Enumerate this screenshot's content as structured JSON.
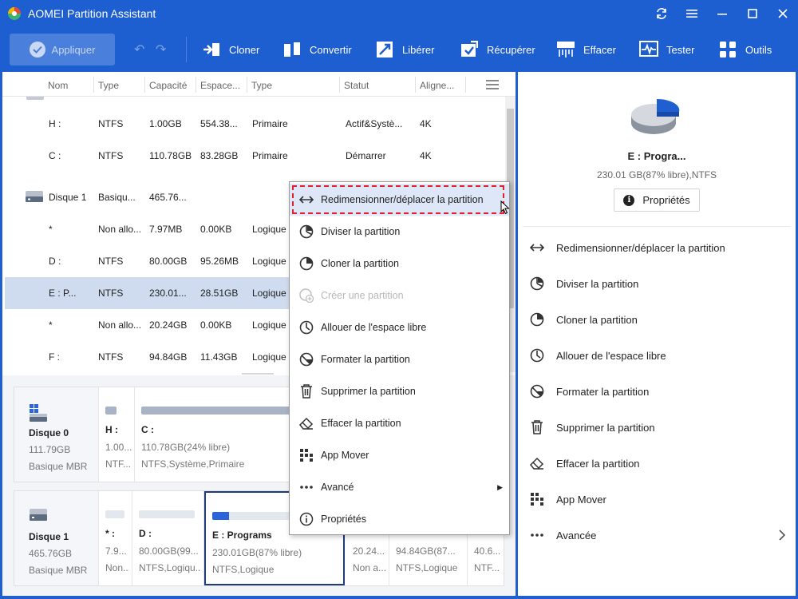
{
  "titlebar": {
    "title": "AOMEI Partition Assistant"
  },
  "toolbar": {
    "apply_label": "Appliquer",
    "buttons": [
      {
        "label": "Cloner",
        "icon": "clone-icon"
      },
      {
        "label": "Convertir",
        "icon": "convert-icon"
      },
      {
        "label": "Libérer",
        "icon": "free-up-icon"
      },
      {
        "label": "Récupérer",
        "icon": "recover-icon"
      },
      {
        "label": "Effacer",
        "icon": "wipe-icon"
      },
      {
        "label": "Tester",
        "icon": "test-icon"
      },
      {
        "label": "Outils",
        "icon": "tools-icon"
      }
    ]
  },
  "table": {
    "headers": [
      "Nom",
      "Type",
      "Capacité",
      "Espace...",
      "Type",
      "Statut",
      "Aligne..."
    ],
    "rows": [
      {
        "name": "H :",
        "fs": "NTFS",
        "cap": "1.00GB",
        "free": "554.38...",
        "type": "Primaire",
        "status": "Actif&Systè...",
        "align": "4K"
      },
      {
        "name": "C :",
        "fs": "NTFS",
        "cap": "110.78GB",
        "free": "83.28GB",
        "type": "Primaire",
        "status": "Démarrer",
        "align": "4K"
      },
      {
        "name": "Disque 1",
        "fs": "Basiqu...",
        "cap": "465.76...",
        "free": "",
        "type": "",
        "status": "",
        "align": ""
      },
      {
        "name": "*",
        "fs": "Non allo...",
        "cap": "7.97MB",
        "free": "0.00KB",
        "type": "Logique",
        "status": "",
        "align": ""
      },
      {
        "name": "D :",
        "fs": "NTFS",
        "cap": "80.00GB",
        "free": "95.26MB",
        "type": "Logique",
        "status": "",
        "align": ""
      },
      {
        "name": "E : P...",
        "fs": "NTFS",
        "cap": "230.01...",
        "free": "28.51GB",
        "type": "Logique",
        "status": "",
        "align": ""
      },
      {
        "name": "*",
        "fs": "Non allo...",
        "cap": "20.24GB",
        "free": "0.00KB",
        "type": "Logique",
        "status": "",
        "align": ""
      },
      {
        "name": "F :",
        "fs": "NTFS",
        "cap": "94.84GB",
        "free": "11.43GB",
        "type": "Logique",
        "status": "",
        "align": ""
      }
    ]
  },
  "disk0": {
    "name": "Disque 0",
    "size": "111.79GB",
    "type": "Basique MBR",
    "parts": [
      {
        "l1": "H :",
        "l2": "1.00...",
        "l3": "NTF...",
        "used": 0.45
      },
      {
        "l1": "C :",
        "l2": "110.78GB(24% libre)",
        "l3": "NTFS,Système,Primaire",
        "used": 0.76
      }
    ]
  },
  "disk1": {
    "name": "Disque 1",
    "size": "465.76GB",
    "type": "Basique MBR",
    "parts": [
      {
        "l1": "* :",
        "l2": "7.9...",
        "l3": "Non...",
        "used": 0
      },
      {
        "l1": "D :",
        "l2": "80.00GB(99...",
        "l3": "NTFS,Logiqu...",
        "used": 0
      },
      {
        "l1": "E : Programs",
        "l2": "230.01GB(87% libre)",
        "l3": "NTFS,Logique",
        "used": 0.13
      },
      {
        "l1": "",
        "l2": "20.24...",
        "l3": "Non a...",
        "used": 0
      },
      {
        "l1": "",
        "l2": "94.84GB(87...",
        "l3": "NTFS,Logique",
        "used": 0
      },
      {
        "l1": "",
        "l2": "40.6...",
        "l3": "NTF...",
        "used": 0
      }
    ]
  },
  "context_menu": {
    "items": [
      {
        "label": "Redimensionner/déplacer la partition",
        "icon": "resize-icon"
      },
      {
        "label": "Diviser la partition",
        "icon": "split-icon"
      },
      {
        "label": "Cloner la partition",
        "icon": "clone-partition-icon"
      },
      {
        "label": "Créer une partition",
        "icon": "create-icon",
        "disabled": true
      },
      {
        "label": "Allouer de l'espace libre",
        "icon": "allocate-icon"
      },
      {
        "label": "Formater la partition",
        "icon": "format-icon"
      },
      {
        "label": "Supprimer la partition",
        "icon": "trash-icon"
      },
      {
        "label": "Effacer la partition",
        "icon": "eraser-icon"
      },
      {
        "label": "App Mover",
        "icon": "app-mover-icon"
      },
      {
        "label": "Avancé",
        "icon": "more-icon",
        "submenu": true
      },
      {
        "label": "Propriétés",
        "icon": "info-icon"
      }
    ]
  },
  "right_panel": {
    "name": "E : Progra...",
    "info": "230.01 GB(87% libre),NTFS",
    "properties_label": "Propriétés",
    "items": [
      {
        "label": "Redimensionner/déplacer la partition"
      },
      {
        "label": "Diviser la partition"
      },
      {
        "label": "Cloner la partition"
      },
      {
        "label": "Allouer de l'espace libre"
      },
      {
        "label": "Formater la partition"
      },
      {
        "label": "Supprimer la partition"
      },
      {
        "label": "Effacer la partition"
      },
      {
        "label": "App Mover"
      },
      {
        "label": "Avancée"
      }
    ]
  },
  "colors": {
    "titlebar": "#1d5fd0",
    "accent": "#2c64dc",
    "highlight_border": "#e0202a",
    "selected_row": "#cfdcef"
  }
}
